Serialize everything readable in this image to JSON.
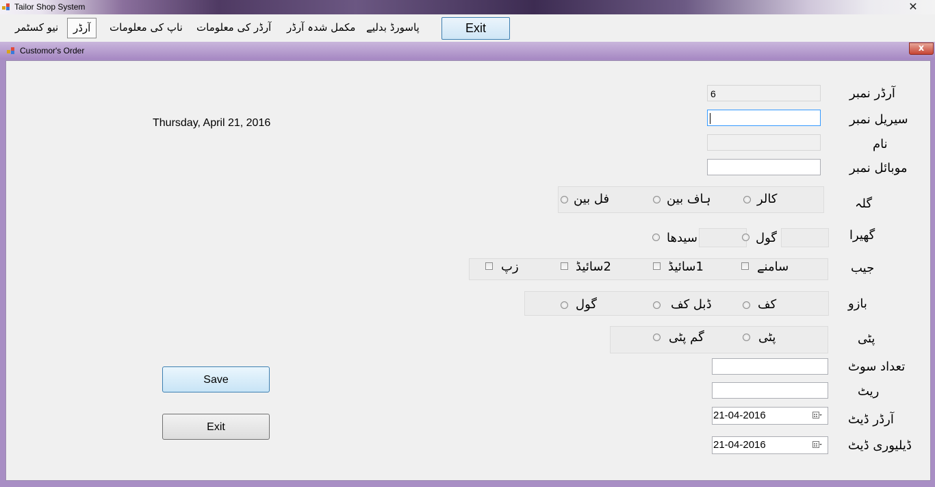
{
  "window": {
    "title": "Tailor Shop System",
    "close": "✕"
  },
  "menu": {
    "new_customer": "نیو کسٹمر",
    "order": "آرڈر",
    "measurement_info": "ناپ کی معلومات",
    "order_info": "آرڈر کی معلومات",
    "completed_orders": "مکمل شدہ آرڈر",
    "change_password": "پاسورڈ بدلیے",
    "exit": "Exit"
  },
  "child": {
    "title": "Customor's Order",
    "close": "x"
  },
  "form": {
    "current_date": "Thursday, April 21, 2016",
    "labels": {
      "order_number": "آرڈر نمبر",
      "serial_number": "سیریل نمبر",
      "name": "نام",
      "mobile_number": "موبائل نمبر",
      "collar": "گلہ",
      "hem": "گھیرا",
      "pocket": "جیب",
      "sleeve": "بازو",
      "placket": "پٹی",
      "suit_count": "تعداد سوٹ",
      "rate": "ریٹ",
      "order_date": "آرڈر ڈیٹ",
      "delivery_date": "ڈیلیوری ڈیٹ"
    },
    "fields": {
      "order_number": "6",
      "serial_number": "",
      "name": "",
      "mobile_number": "",
      "suit_count": "",
      "rate": "",
      "order_date": "21-04-2016",
      "delivery_date": "21-04-2016"
    },
    "collar_options": [
      "کالر",
      "ہاف بین",
      "فل بین"
    ],
    "hem_options": [
      "گول",
      "سیدھا"
    ],
    "pocket_options": [
      "سامنے",
      "1سائیڈ",
      "2سائیڈ",
      "زپ"
    ],
    "sleeve_options": [
      "کف",
      "ڈبل کف",
      "گول"
    ],
    "placket_options": [
      "پٹی",
      "گم پٹی"
    ],
    "buttons": {
      "save": "Save",
      "exit": "Exit"
    }
  }
}
